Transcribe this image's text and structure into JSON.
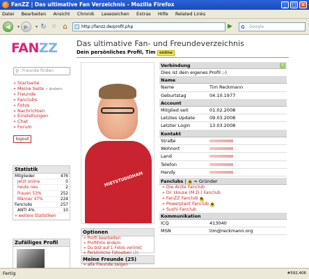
{
  "window": {
    "title": "FanZZ | Das ultimative Fan Verzeichnis - Mozilla Firefox"
  },
  "menu": [
    "Datei",
    "Bearbeiten",
    "Ansicht",
    "Chronik",
    "Lesezeichen",
    "Extras",
    "Hilfe",
    "Related Links"
  ],
  "toolbar": {
    "url": "http://fanzz.de/profil.php",
    "search_placeholder": "Google"
  },
  "brand": {
    "logo_fan": "FAN",
    "logo_zz": "ZZ",
    "search_placeholder": "Freunde finden"
  },
  "page": {
    "title": "Das ultimative Fan- und Freundeverzeichnis",
    "subtitle": "Dein persönliches Profil, Tim",
    "status_badge": "online"
  },
  "nav": [
    {
      "label": "Startseite"
    },
    {
      "label": "Meine Seite",
      "extra": "» ändern"
    },
    {
      "label": "Freunde"
    },
    {
      "label": "Fanclubs"
    },
    {
      "label": "Fotos"
    },
    {
      "label": "Nachrichten"
    },
    {
      "label": "Einstellungen"
    },
    {
      "label": "Chat"
    },
    {
      "label": "Forum"
    }
  ],
  "logout_label": "logout",
  "stats": {
    "title": "Statistik",
    "rows": [
      {
        "label": "Mitglieder",
        "value": "476",
        "pct": ""
      },
      {
        "label": "jetzt online",
        "value": "0",
        "pct": "",
        "indent": true
      },
      {
        "label": "heute neu",
        "value": "2",
        "pct": "",
        "indent": true
      },
      {
        "label": "Frauen 53%",
        "value": "252",
        "pct": "",
        "indent": true
      },
      {
        "label": "Männer 47%",
        "value": "224",
        "pct": "",
        "indent": true
      },
      {
        "label": "Fanclubs",
        "value": "257",
        "pct": ""
      },
      {
        "label": "ANTI 4%",
        "value": "10",
        "pct": "",
        "indent": true
      }
    ],
    "more": "» weitere Statistiken"
  },
  "random_profile_title": "Zufälliges Profil",
  "options": {
    "title": "Optionen",
    "items": [
      {
        "label": "Profil bearbeiten"
      },
      {
        "label": "Profilfoto ändern"
      },
      {
        "label": "Du bist auf 1 Fotos verlinkt"
      },
      {
        "label": "Persönliche Fotoalben",
        "count": "(3)"
      }
    ]
  },
  "friends": {
    "title": "Meine Freunde (25)",
    "all_link": "» alle Freunde zeigen"
  },
  "photo": {
    "shirt_text": "MIETSTUDIOHAM"
  },
  "profile": {
    "verbindung": {
      "title": "Verbindung",
      "text": "Dies ist dein eigenes Profil ;-)"
    },
    "name_section": {
      "title": "Name",
      "rows": [
        {
          "k": "Name",
          "v": "Tim Reckmann"
        },
        {
          "k": "Geburtstag",
          "v": "04.10.1977"
        }
      ]
    },
    "account": {
      "title": "Account",
      "rows": [
        {
          "k": "Mitglied seit",
          "v": "01.02.2008"
        },
        {
          "k": "Letztes Update",
          "v": "09.03.2008"
        },
        {
          "k": "Letzter Login",
          "v": "13.03.2008"
        }
      ]
    },
    "kontakt": {
      "title": "Kontakt",
      "rows": [
        {
          "k": "Straße",
          "v": ""
        },
        {
          "k": "Wohnort",
          "v": ""
        },
        {
          "k": "Land",
          "v": ""
        },
        {
          "k": "Telefon",
          "v": ""
        },
        {
          "k": "Handy",
          "v": ""
        }
      ]
    },
    "fanclubs": {
      "title": "Fanclubs",
      "legend_sep": "|",
      "legend": "= Gründer",
      "items": [
        {
          "label": "Die Ärzte Fanclub",
          "founder": false
        },
        {
          "label": "Dr. House (M.D.) Fanclub",
          "founder": false
        },
        {
          "label": "FanZZ Fanclub",
          "founder": true
        },
        {
          "label": "Powerplant Fanclub",
          "founder": true
        },
        {
          "label": "Sushi Fanclub",
          "founder": false
        }
      ]
    },
    "kommunikation": {
      "title": "Kommunikation",
      "rows": [
        {
          "k": "ICQ",
          "v": "413040"
        },
        {
          "k": "MSN",
          "v": "tim@reckmann.org"
        }
      ]
    }
  },
  "status": {
    "text": "Fertig",
    "right": "#592,406"
  }
}
